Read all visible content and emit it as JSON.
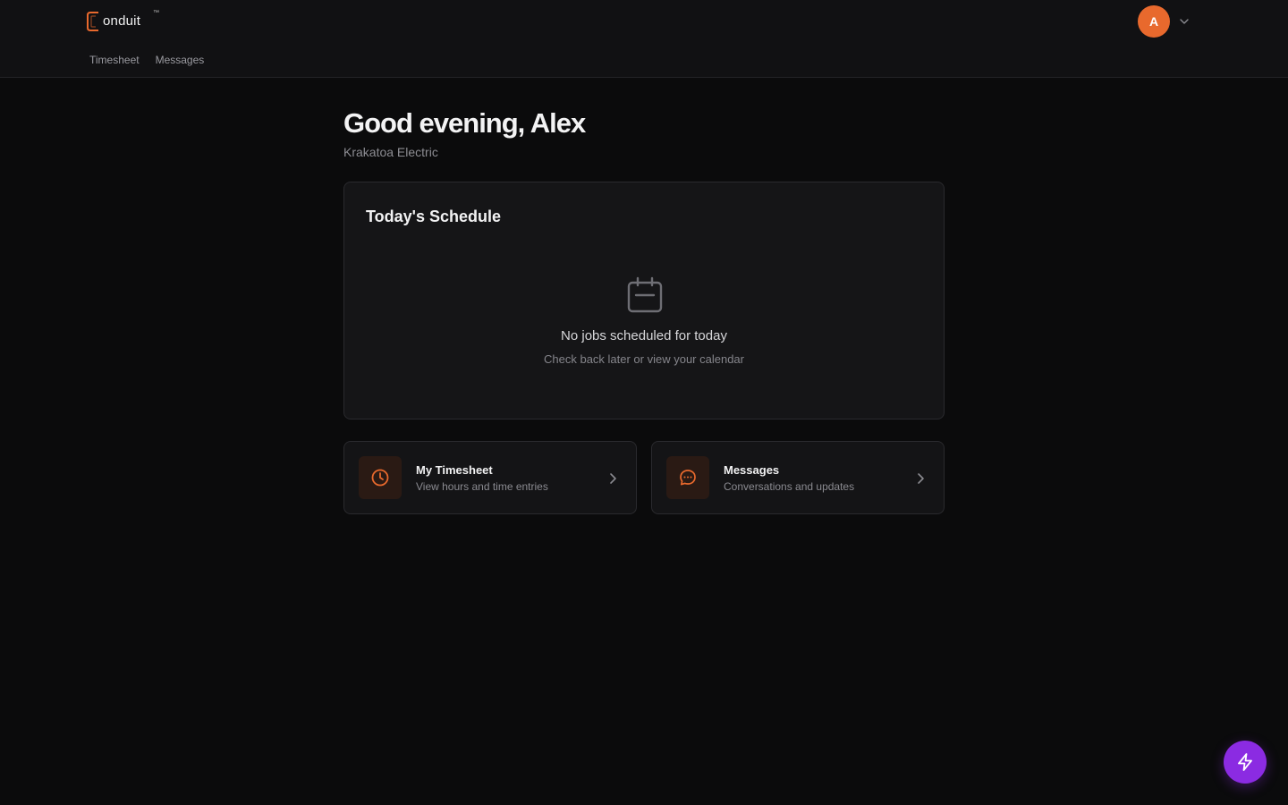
{
  "brand": {
    "name": "onduit",
    "tm": "™",
    "accent": "#e8692d"
  },
  "nav": {
    "items": [
      {
        "label": "Timesheet"
      },
      {
        "label": "Messages"
      }
    ]
  },
  "user": {
    "initial": "A"
  },
  "greeting": {
    "title": "Good evening, Alex",
    "company": "Krakatoa Electric"
  },
  "schedule": {
    "title": "Today's Schedule",
    "empty_icon": "calendar-icon",
    "empty_title": "No jobs scheduled for today",
    "empty_subtitle": "Check back later or view your calendar"
  },
  "quick_links": [
    {
      "title": "My Timesheet",
      "subtitle": "View hours and time entries",
      "icon": "clock-icon"
    },
    {
      "title": "Messages",
      "subtitle": "Conversations and updates",
      "icon": "message-icon"
    }
  ],
  "fab": {
    "icon": "lightning-icon",
    "color": "#8b2be2"
  }
}
